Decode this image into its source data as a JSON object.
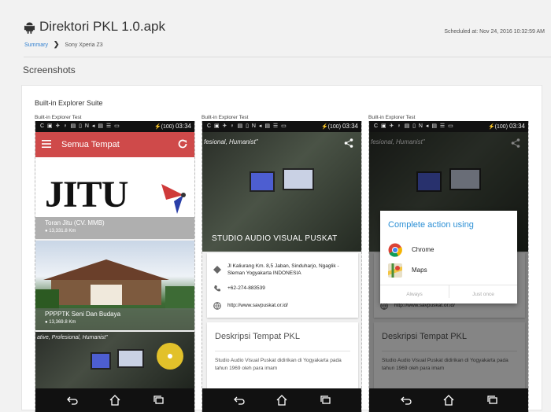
{
  "header": {
    "app_title": "Direktori PKL 1.0.apk",
    "breadcrumb": {
      "summary": "Summary",
      "device": "Sony Xperia Z3"
    },
    "scheduled": "Scheduled at: Nov 24, 2016 10:32:59 AM"
  },
  "section_title": "Screenshots",
  "suite_title": "Built-in Explorer Suite",
  "status_bar": {
    "left_icons": "C ▣ ✈ ♀ ▤ ▯ N ◂ ▤ ☰ ▭",
    "battery": "100",
    "time": "03:34"
  },
  "shots": [
    {
      "label": "Built-in Explorer Test",
      "app_bar_title": "Semua Tempat",
      "logo_text": "JITU",
      "places": [
        {
          "name": "Toran Jitu (CV. MMB)",
          "distance": "13,331.8 Km"
        },
        {
          "name": "PPPPTK Seni Dan Budaya",
          "distance": "13,369.8 Km"
        }
      ],
      "quote": "ative, Profesional, Humanist\""
    },
    {
      "label": "Built-in Explorer Test",
      "hero_quote": "fesional, Humanist\"",
      "hero_caption": "STUDIO AUDIO VISUAL PUSKAT",
      "address": "Jl Kaliurang Km. 8,5 Jaban, Sinduharjo, Ngaglik - Sleman Yogyakarta INDONESIA",
      "phone": "+62-274-883539",
      "website": "http://www.savpuskat.or.id/",
      "desc_heading": "Deskripsi Tempat PKL",
      "desc_body": "Studio Audio Visual Puskat didirikan di Yogyakarta pada tahun 1969 oleh para imam"
    },
    {
      "label": "Built-in Explorer Test",
      "hero_quote": "fesional, Humanist\"",
      "dialog_title": "Complete action using",
      "options": [
        "Chrome",
        "Maps"
      ],
      "buttons": {
        "always": "Always",
        "just_once": "Just once"
      },
      "website": "http://www.savpuskat.or.id/",
      "desc_heading": "Deskripsi Tempat PKL",
      "desc_body": "Studio Audio Visual Puskat didirikan di Yogyakarta pada tahun 1969 oleh para imam"
    }
  ],
  "colors": {
    "app_bar": "#cf4a4a",
    "link": "#2f7fd0",
    "dialog_title": "#2b8fd5",
    "fab": "#e2c12a"
  }
}
